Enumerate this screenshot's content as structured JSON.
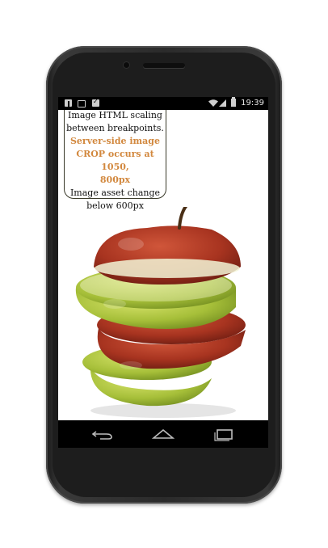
{
  "statusbar": {
    "time": "19:39",
    "left_icons": [
      "facebook-icon",
      "gallery-icon",
      "shopping-bag-icon"
    ],
    "right_icons": [
      "wifi-icon",
      "signal-icon",
      "battery-icon"
    ]
  },
  "caption": {
    "line1": "Image HTML scaling",
    "line2": "between breakpoints.",
    "accent_line1": "Server-side image",
    "accent_line2": "CROP occurs at 1050,",
    "accent_line3": "800px",
    "line4": "Image asset change",
    "line5": "below 600px",
    "accent_color": "#d2883e"
  },
  "image": {
    "subject": "sliced-apple",
    "colors": {
      "red": "#b33a23",
      "green": "#a9c23c"
    }
  },
  "navbar": {
    "buttons": [
      "back-icon",
      "home-icon",
      "recent-apps-icon"
    ]
  }
}
